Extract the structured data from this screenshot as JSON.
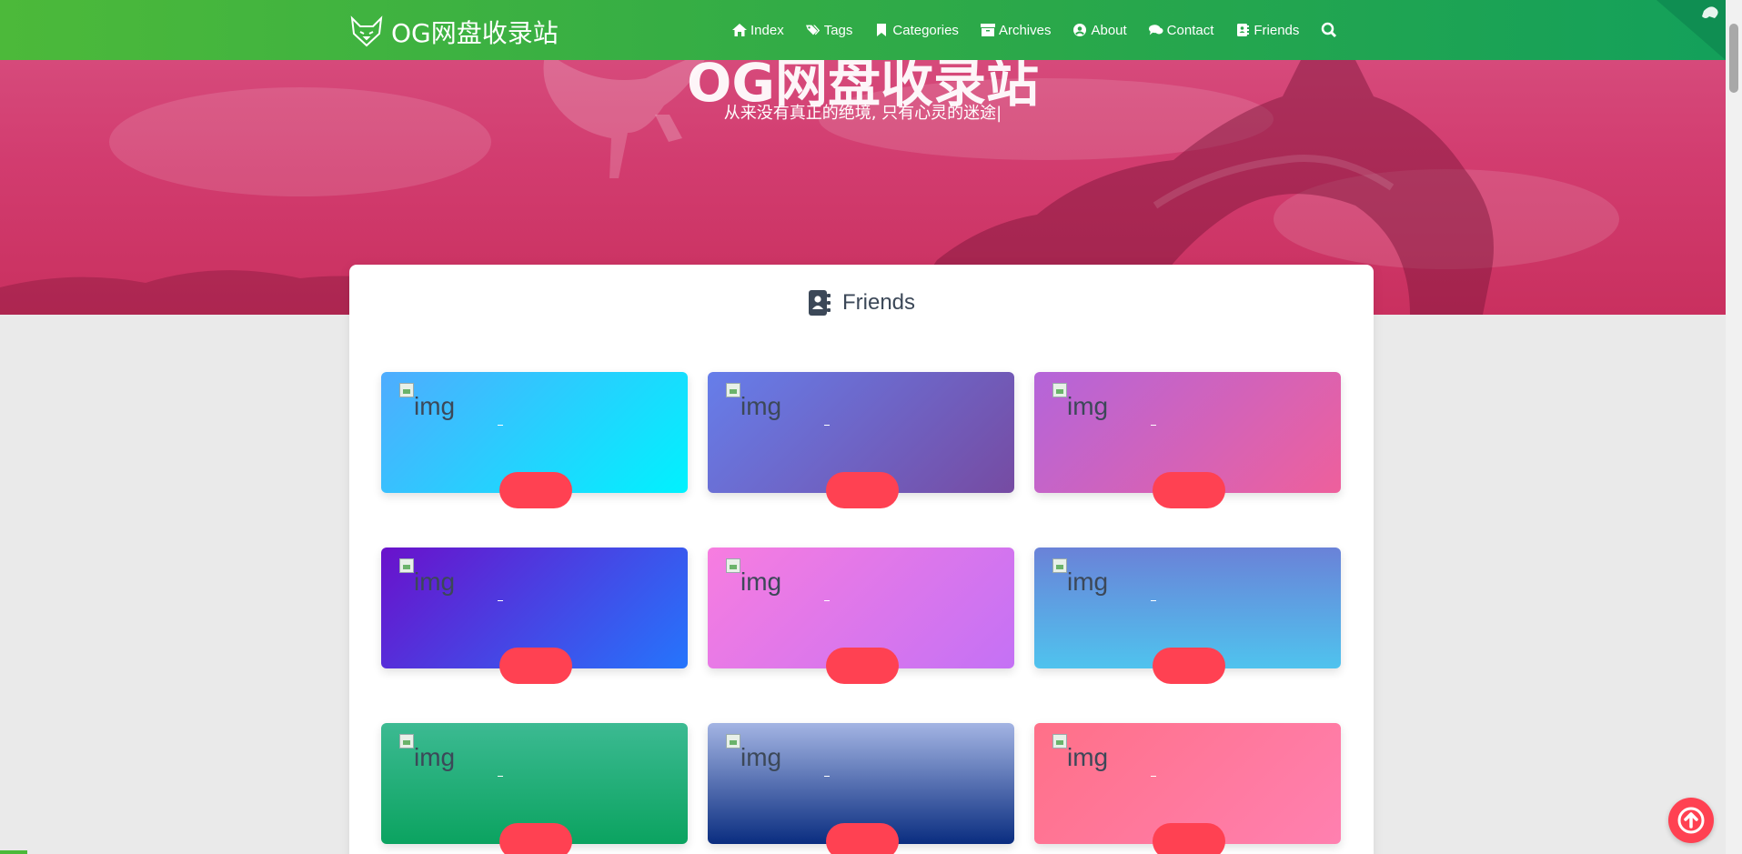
{
  "header": {
    "brand": "OG网盘收录站",
    "nav": [
      {
        "label": "Index",
        "icon": "home-icon"
      },
      {
        "label": "Tags",
        "icon": "tags-icon"
      },
      {
        "label": "Categories",
        "icon": "bookmark-icon"
      },
      {
        "label": "Archives",
        "icon": "archive-icon"
      },
      {
        "label": "About",
        "icon": "user-circle-icon"
      },
      {
        "label": "Contact",
        "icon": "comments-icon"
      },
      {
        "label": "Friends",
        "icon": "address-book-icon"
      }
    ],
    "search_icon": "search-icon",
    "colors": {
      "start": "#4cb93a",
      "end": "#13a05b"
    }
  },
  "banner": {
    "title": "OG网盘收录站",
    "subtitle": "从来没有真正的绝境, 只有心灵的迷途|",
    "color": "#d23c6f"
  },
  "section": {
    "title": "Friends",
    "icon": "address-book-icon"
  },
  "friends": [
    {
      "alt": "img",
      "gradient": [
        "#4facfe",
        "#00f2fe"
      ]
    },
    {
      "alt": "img",
      "gradient": [
        "#667eea",
        "#764ba2"
      ]
    },
    {
      "alt": "img",
      "gradient": [
        "#b465da",
        "#ee609c"
      ]
    },
    {
      "alt": "img",
      "gradient": [
        "#6a11cb",
        "#2575fc"
      ]
    },
    {
      "alt": "img",
      "gradient": [
        "#f77de0",
        "#c471f5"
      ]
    },
    {
      "alt": "img",
      "gradient": [
        "#6a82d8",
        "#4fc3ee"
      ]
    },
    {
      "alt": "img",
      "gradient": [
        "#3cba92",
        "#0ba360"
      ]
    },
    {
      "alt": "img",
      "gradient": [
        "#a3b4e3",
        "#0a2d80"
      ]
    },
    {
      "alt": "img",
      "gradient": [
        "#ff7088",
        "#ff80b0"
      ]
    }
  ],
  "accent": "#ff4152",
  "back_to_top_icon": "arrow-up-icon"
}
